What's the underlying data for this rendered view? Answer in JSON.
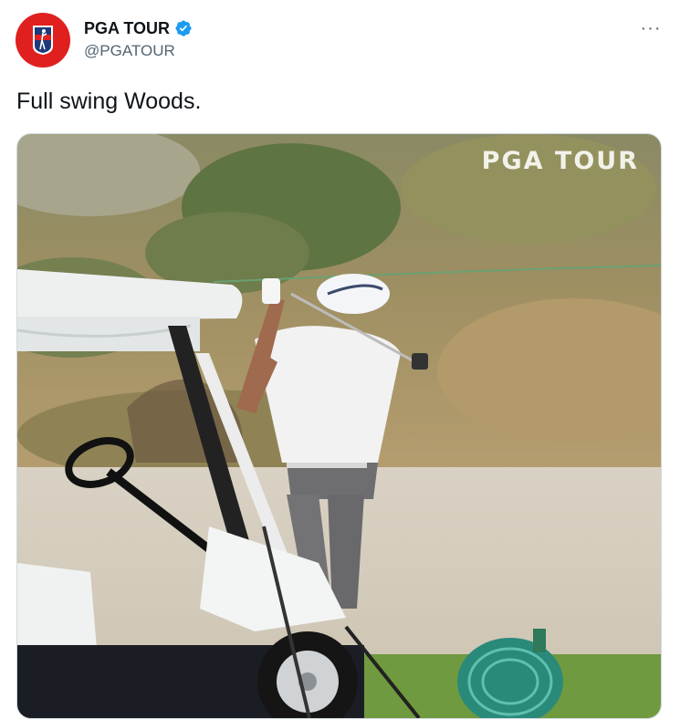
{
  "author": {
    "display_name": "PGA TOUR",
    "handle": "@PGATOUR",
    "avatar_icon": "pga-tour-logo-icon",
    "verified_icon": "verified-badge-icon",
    "brand_color": "#e0201f",
    "verified_color": "#1d9bf0"
  },
  "menu": {
    "more_icon": "more-dots-icon",
    "more_label": "···"
  },
  "tweet": {
    "text": "Full swing Woods."
  },
  "media": {
    "watermark": "PGA TOUR"
  }
}
